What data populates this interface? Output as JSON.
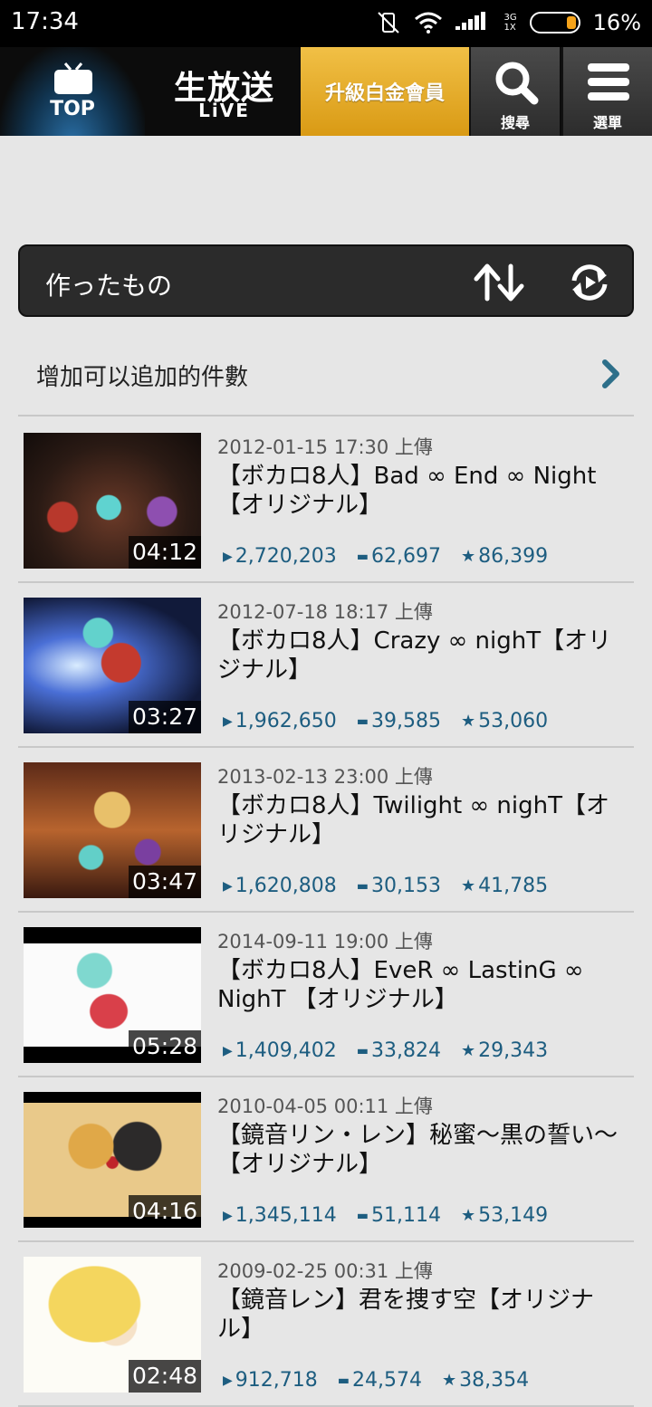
{
  "status_bar": {
    "time": "17:34",
    "network": "3G\n1X",
    "battery_text": "16%"
  },
  "nav": {
    "top_label": "TOP",
    "live_label_main": "生放送",
    "live_label_sub": "LiVE",
    "upgrade_label": "升級白金會員",
    "search_label": "搜尋",
    "menu_label": "選單"
  },
  "header": {
    "title": "作ったもの"
  },
  "add_more": {
    "label": "增加可以追加的件數"
  },
  "videos": [
    {
      "date": "2012-01-15 17:30 上傳",
      "title": "【ボカロ8人】Bad ∞ End ∞ Night【オリジナル】",
      "duration": "04:12",
      "views": "2,720,203",
      "comments": "62,697",
      "mylists": "86,399"
    },
    {
      "date": "2012-07-18 18:17 上傳",
      "title": "【ボカロ8人】Crazy ∞ nighT【オリジナル】",
      "duration": "03:27",
      "views": "1,962,650",
      "comments": "39,585",
      "mylists": "53,060"
    },
    {
      "date": "2013-02-13 23:00 上傳",
      "title": "【ボカロ8人】Twilight ∞ nighT【オリジナル】",
      "duration": "03:47",
      "views": "1,620,808",
      "comments": "30,153",
      "mylists": "41,785"
    },
    {
      "date": "2014-09-11 19:00 上傳",
      "title": "【ボカロ8人】EveR ∞ LastinG ∞ NighT 【オリジナル】",
      "duration": "05:28",
      "views": "1,409,402",
      "comments": "33,824",
      "mylists": "29,343"
    },
    {
      "date": "2010-04-05 00:11 上傳",
      "title": "【鏡音リン・レン】秘蜜〜黒の誓い〜【オリジナル】",
      "duration": "04:16",
      "views": "1,345,114",
      "comments": "51,114",
      "mylists": "53,149"
    },
    {
      "date": "2009-02-25 00:31 上傳",
      "title": "【鏡音レン】君を捜す空【オリジナル】",
      "duration": "02:48",
      "views": "912,718",
      "comments": "24,574",
      "mylists": "38,354"
    }
  ],
  "colors": {
    "accent": "#e0a420",
    "stat": "#1d5d80",
    "panel": "#2b2b2b"
  }
}
